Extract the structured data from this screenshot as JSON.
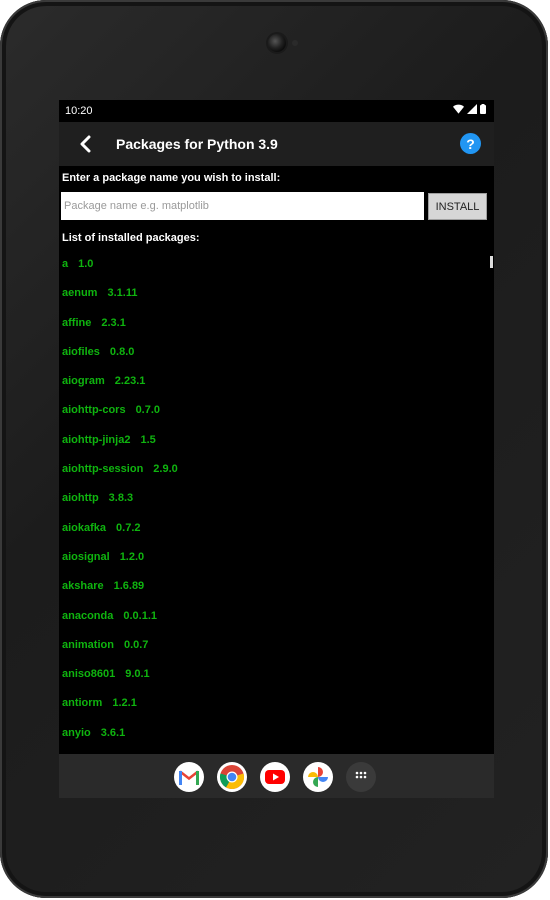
{
  "status": {
    "time": "10:20"
  },
  "header": {
    "title": "Packages for Python 3.9"
  },
  "install": {
    "prompt": "Enter a package name you wish to install:",
    "placeholder": "Package name e.g. matplotlib",
    "value": "",
    "button_label": "INSTALL"
  },
  "packages": {
    "label": "List of installed packages:",
    "items": [
      {
        "name": "a",
        "version": "1.0"
      },
      {
        "name": "aenum",
        "version": "3.1.11"
      },
      {
        "name": "affine",
        "version": "2.3.1"
      },
      {
        "name": "aiofiles",
        "version": "0.8.0"
      },
      {
        "name": "aiogram",
        "version": "2.23.1"
      },
      {
        "name": "aiohttp-cors",
        "version": "0.7.0"
      },
      {
        "name": "aiohttp-jinja2",
        "version": "1.5"
      },
      {
        "name": "aiohttp-session",
        "version": "2.9.0"
      },
      {
        "name": "aiohttp",
        "version": "3.8.3"
      },
      {
        "name": "aiokafka",
        "version": "0.7.2"
      },
      {
        "name": "aiosignal",
        "version": "1.2.0"
      },
      {
        "name": "akshare",
        "version": "1.6.89"
      },
      {
        "name": "anaconda",
        "version": "0.0.1.1"
      },
      {
        "name": "animation",
        "version": "0.0.7"
      },
      {
        "name": "aniso8601",
        "version": "9.0.1"
      },
      {
        "name": "antiorm",
        "version": "1.2.1"
      },
      {
        "name": "anyio",
        "version": "3.6.1"
      }
    ]
  },
  "dock": {
    "icons": [
      "gmail-icon",
      "chrome-icon",
      "youtube-icon",
      "google-photos-icon",
      "app-drawer-icon"
    ]
  },
  "colors": {
    "package_text": "#0fb40f",
    "help_accent": "#2196f3",
    "appbar_bg": "#1f1f1f"
  }
}
